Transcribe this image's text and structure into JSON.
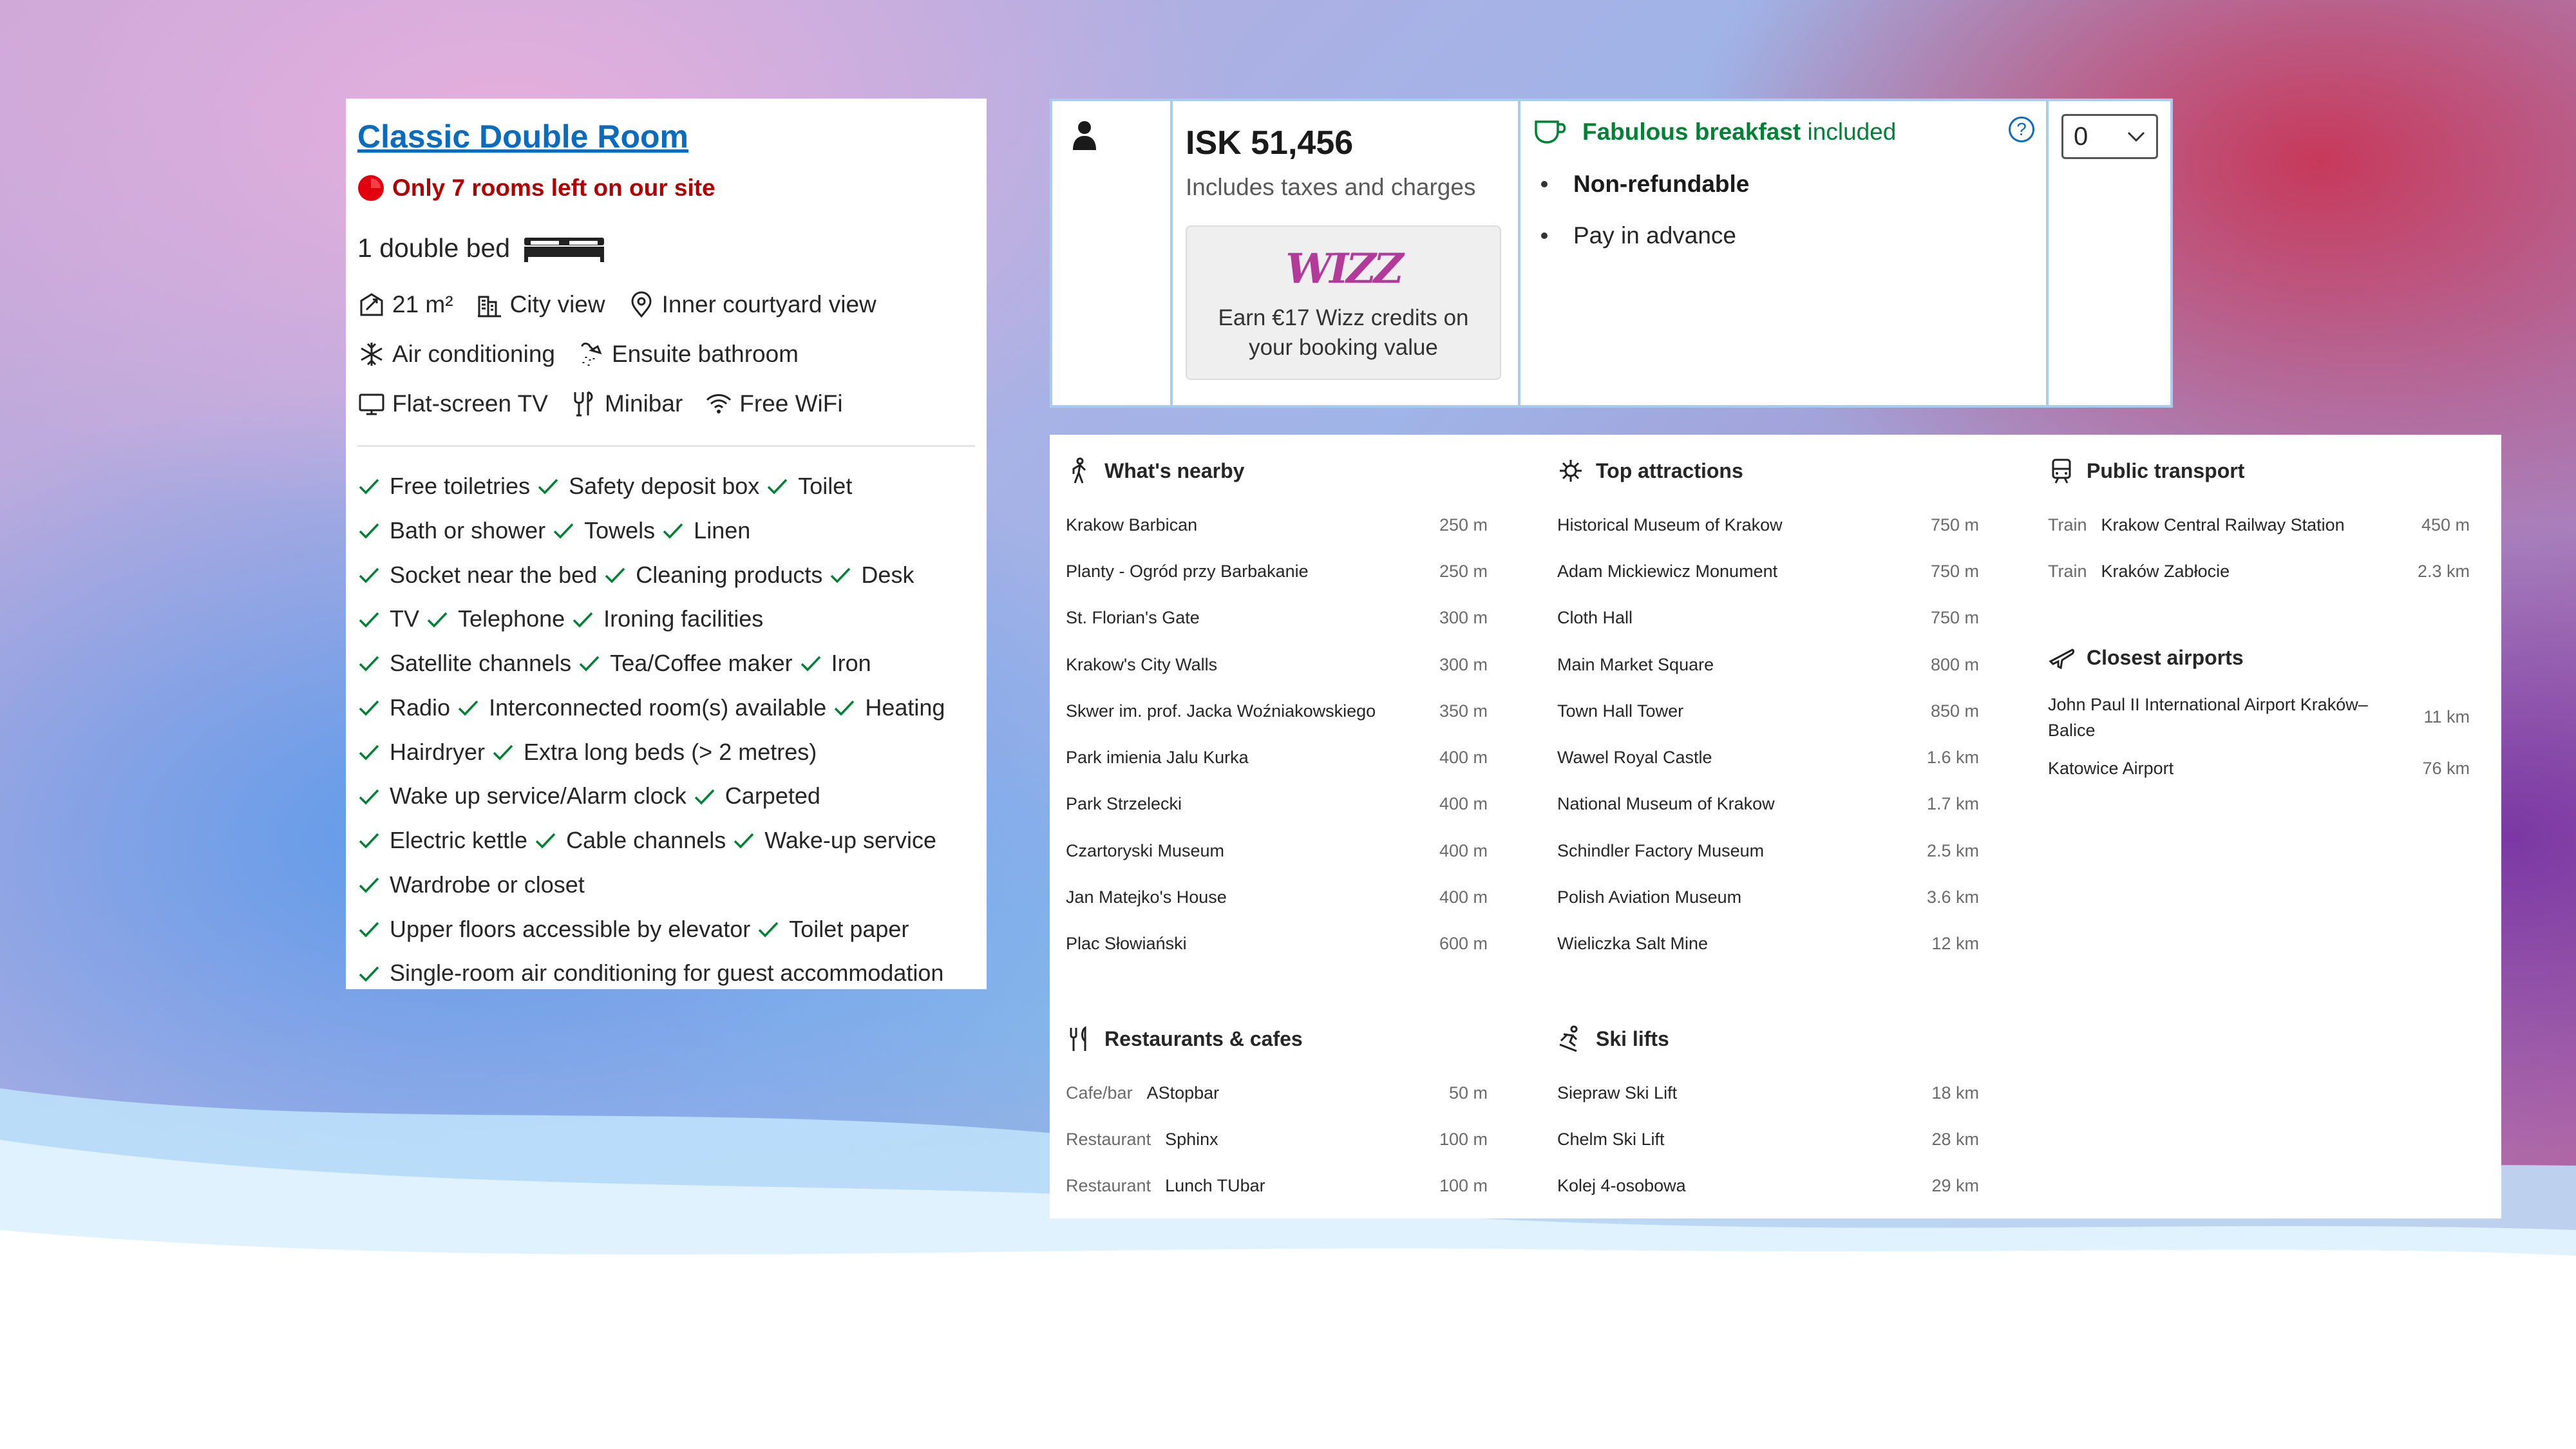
{
  "room": {
    "title": "Classic Double Room",
    "scarcity": "Only 7 rooms left on our site",
    "bed": "1 double bed",
    "facilities": [
      [
        {
          "label": "21 m²",
          "icon": "room-size-icon"
        },
        {
          "label": "City view",
          "icon": "city-icon"
        },
        {
          "label": "Inner courtyard view",
          "icon": "location-icon"
        }
      ],
      [
        {
          "label": "Air conditioning",
          "icon": "snowflake-icon"
        },
        {
          "label": "Ensuite bathroom",
          "icon": "shower-icon"
        }
      ],
      [
        {
          "label": "Flat-screen TV",
          "icon": "tv-icon"
        },
        {
          "label": "Minibar",
          "icon": "minibar-icon"
        },
        {
          "label": "Free WiFi",
          "icon": "wifi-icon"
        }
      ]
    ],
    "amenities": [
      [
        "Free toiletries",
        "Safety deposit box",
        "Toilet"
      ],
      [
        "Bath or shower",
        "Towels",
        "Linen"
      ],
      [
        "Socket near the bed",
        "Cleaning products",
        "Desk"
      ],
      [
        "TV",
        "Telephone",
        "Ironing facilities"
      ],
      [
        "Satellite channels",
        "Tea/Coffee maker",
        "Iron"
      ],
      [
        "Radio",
        "Interconnected room(s) available",
        "Heating"
      ],
      [
        "Hairdryer",
        "Extra long beds (> 2 metres)"
      ],
      [
        "Wake up service/Alarm clock",
        "Carpeted"
      ],
      [
        "Electric kettle",
        "Cable channels",
        "Wake-up service"
      ],
      [
        "Wardrobe or closet"
      ],
      [
        "Upper floors accessible by elevator",
        "Toilet paper"
      ],
      [
        "Single-room air conditioning for guest accommodation"
      ]
    ]
  },
  "booking": {
    "occupancy_icon": "person-icon",
    "price": "ISK 51,456",
    "taxes": "Includes taxes and charges",
    "wizz_logo": "WIZZ",
    "wizz_text_1": "Earn €17 Wizz credits on",
    "wizz_text_2": "your booking value",
    "breakfast_strong": "Fabulous breakfast",
    "breakfast_rest": " included",
    "conditions": [
      "Non-refundable",
      "Pay in advance"
    ],
    "help_icon": "?",
    "select_value": "0",
    "colors": {
      "green": "#008234",
      "blue": "#0a6cbf",
      "border": "#a9cbee"
    }
  },
  "surroundings": {
    "nearby": {
      "title": "What's nearby",
      "items": [
        {
          "name": "Krakow Barbican",
          "dist": "250 m"
        },
        {
          "name": "Planty - Ogród przy Barbakanie",
          "dist": "250 m"
        },
        {
          "name": "St. Florian's Gate",
          "dist": "300 m"
        },
        {
          "name": "Krakow's City Walls",
          "dist": "300 m"
        },
        {
          "name": "Skwer im. prof. Jacka Woźniakowskiego",
          "dist": "350 m"
        },
        {
          "name": "Park imienia Jalu Kurka",
          "dist": "400 m"
        },
        {
          "name": "Park Strzelecki",
          "dist": "400 m"
        },
        {
          "name": "Czartoryski Museum",
          "dist": "400 m"
        },
        {
          "name": "Jan Matejko's House",
          "dist": "400 m"
        },
        {
          "name": "Plac Słowiański",
          "dist": "600 m"
        }
      ]
    },
    "attractions": {
      "title": "Top attractions",
      "items": [
        {
          "name": "Historical Museum of Krakow",
          "dist": "750 m"
        },
        {
          "name": "Adam Mickiewicz Monument",
          "dist": "750 m"
        },
        {
          "name": "Cloth Hall",
          "dist": "750 m"
        },
        {
          "name": "Main Market Square",
          "dist": "800 m"
        },
        {
          "name": "Town Hall Tower",
          "dist": "850 m"
        },
        {
          "name": "Wawel Royal Castle",
          "dist": "1.6 km"
        },
        {
          "name": "National Museum of Krakow",
          "dist": "1.7 km"
        },
        {
          "name": "Schindler Factory Museum",
          "dist": "2.5 km"
        },
        {
          "name": "Polish Aviation Museum",
          "dist": "3.6 km"
        },
        {
          "name": "Wieliczka Salt Mine",
          "dist": "12 km"
        }
      ]
    },
    "transport": {
      "title": "Public transport",
      "items": [
        {
          "cat": "Train",
          "name": "Krakow Central Railway Station",
          "dist": "450 m"
        },
        {
          "cat": "Train",
          "name": "Kraków Zabłocie",
          "dist": "2.3 km"
        }
      ]
    },
    "airports": {
      "title": "Closest airports",
      "items": [
        {
          "name": "John Paul II International Airport Kraków–",
          "name2": "Balice",
          "dist": "11 km"
        },
        {
          "name": "Katowice Airport",
          "dist": "76 km"
        }
      ]
    },
    "restaurants": {
      "title": "Restaurants & cafes",
      "items": [
        {
          "cat": "Cafe/bar",
          "name": "AStopbar",
          "dist": "50 m"
        },
        {
          "cat": "Restaurant",
          "name": "Sphinx",
          "dist": "100 m"
        },
        {
          "cat": "Restaurant",
          "name": "Lunch TUbar",
          "dist": "100 m"
        }
      ]
    },
    "ski": {
      "title": "Ski lifts",
      "items": [
        {
          "name": "Siepraw Ski Lift",
          "dist": "18 km"
        },
        {
          "name": "Chelm Ski Lift",
          "dist": "28 km"
        },
        {
          "name": "Kolej 4-osobowa",
          "dist": "29 km"
        }
      ]
    }
  }
}
